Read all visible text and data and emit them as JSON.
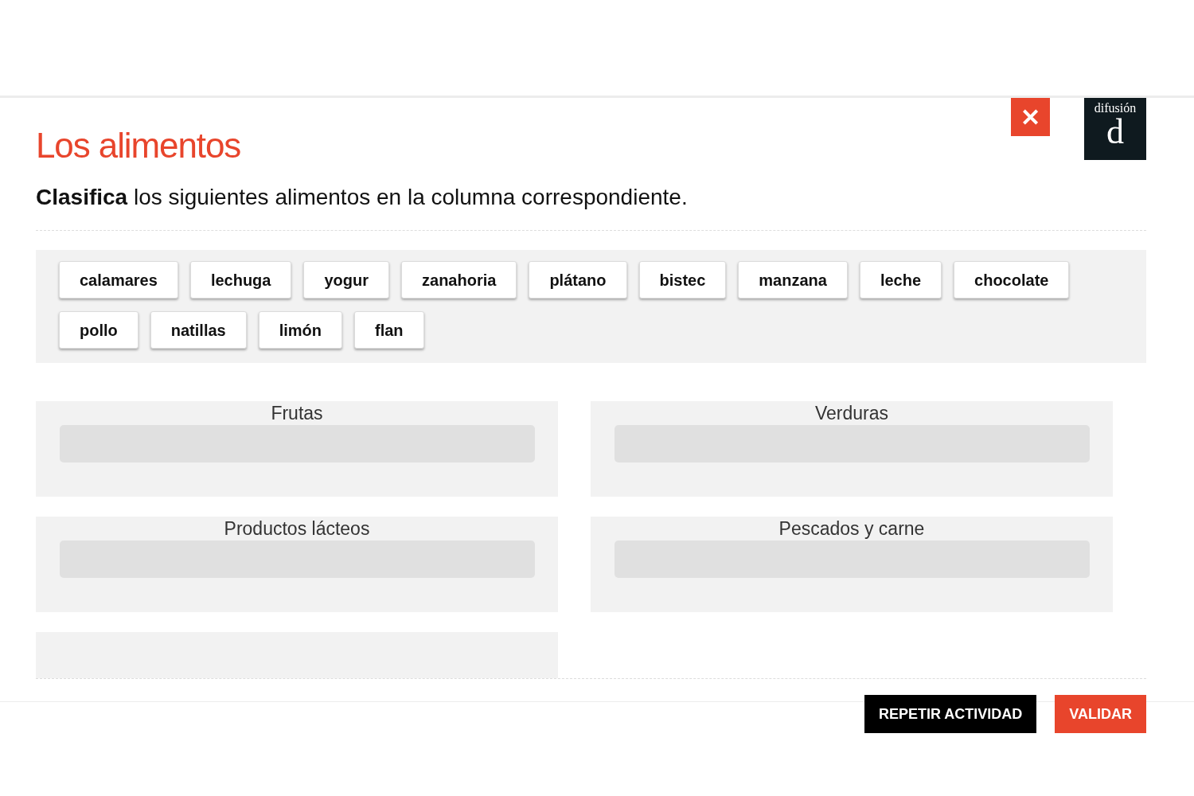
{
  "header": {
    "close_button": "✕",
    "logo": {
      "wordmark": "difusión",
      "letter": "d"
    }
  },
  "title": "Los alimentos",
  "instruction": "**Clasifica** los siguientes alimentos en la columna correspondiente.",
  "words": [
    "calamares",
    "lechuga",
    "yogur",
    "zanahoria",
    "plátano",
    "bistec",
    "manzana",
    "leche",
    "chocolate",
    "pollo",
    "natillas",
    "limón",
    "flan"
  ],
  "categories": [
    {
      "label": "Frutas"
    },
    {
      "label": "Verduras"
    },
    {
      "label": "Productos lácteos"
    },
    {
      "label": "Pescados y carne"
    },
    {
      "kind": "cut"
    }
  ],
  "buttons": [
    {
      "label": "REPETIR ACTIVIDAD",
      "kind": "secondary"
    },
    {
      "label": "VALIDAR",
      "kind": "primary"
    }
  ]
}
